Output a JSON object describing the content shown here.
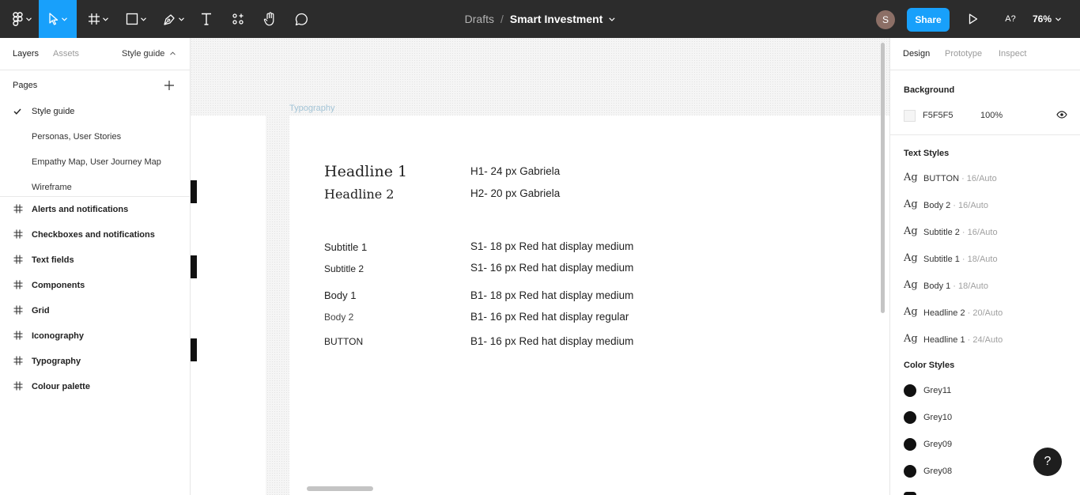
{
  "toolbar": {
    "breadcrumb_parent": "Drafts",
    "breadcrumb_separator": "/",
    "file_name": "Smart Investment",
    "avatar_initial": "S",
    "share_label": "Share",
    "a_label": "A?",
    "zoom": "76%",
    "accent": "#18a0fb"
  },
  "left_panel": {
    "tabs": [
      "Layers",
      "Assets"
    ],
    "current_page_menu": "Style guide",
    "pages_title": "Pages",
    "pages": [
      "Style guide",
      "Personas, User Stories",
      "Empathy Map, User Journey Map",
      "Wireframe"
    ],
    "selected_page": "Style guide",
    "layers": [
      "Alerts and notifications",
      "Checkboxes and notifications",
      "Text fields",
      "Components",
      "Grid",
      "Iconography",
      "Typography",
      "Colour palette"
    ]
  },
  "canvas": {
    "frame_label": "Typography",
    "rows": [
      {
        "left": "Headline 1",
        "right": "H1- 24 px Gabriela"
      },
      {
        "left": "Headline 2",
        "right": "H2- 20 px Gabriela"
      },
      {
        "left": "Subtitle 1",
        "right": "S1- 18 px Red hat display medium"
      },
      {
        "left": "Subtitle 2",
        "right": "S1- 16 px Red hat display medium"
      },
      {
        "left": "Body 1",
        "right": "B1- 18 px Red hat display medium"
      },
      {
        "left": "Body 2",
        "right": "B1- 16 px Red hat display regular"
      },
      {
        "left": "BUTTON",
        "right": "B1- 16 px Red hat display medium"
      }
    ]
  },
  "right_panel": {
    "tabs": [
      "Design",
      "Prototype",
      "Inspect"
    ],
    "background_title": "Background",
    "background_hex": "F5F5F5",
    "background_opacity": "100%",
    "text_styles_title": "Text Styles",
    "ag": "Ag",
    "text_styles": [
      {
        "name": "BUTTON",
        "meta": " · 16/Auto"
      },
      {
        "name": "Body 2",
        "meta": " · 16/Auto"
      },
      {
        "name": "Subtitle 2",
        "meta": " · 16/Auto"
      },
      {
        "name": "Subtitle 1",
        "meta": " · 18/Auto"
      },
      {
        "name": "Body 1",
        "meta": " · 18/Auto"
      },
      {
        "name": "Headline 2",
        "meta": " · 20/Auto"
      },
      {
        "name": "Headline 1",
        "meta": " · 24/Auto"
      }
    ],
    "color_styles_title": "Color Styles",
    "color_styles": [
      "Grey11",
      "Grey10",
      "Grey09",
      "Grey08"
    ],
    "help": "?"
  }
}
